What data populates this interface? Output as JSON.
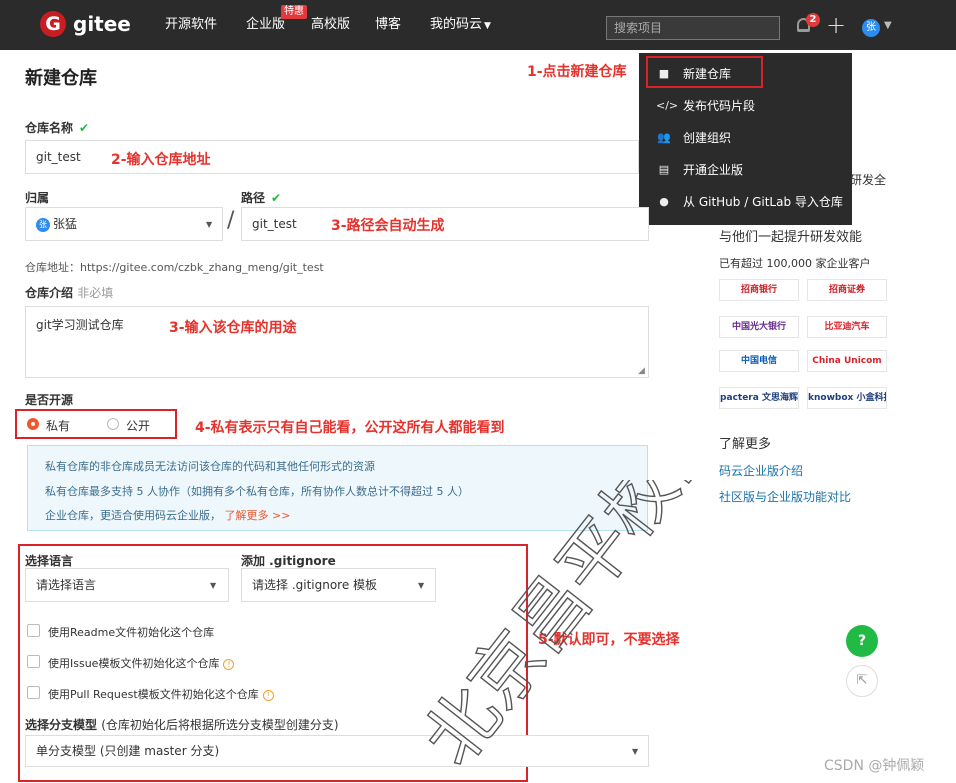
{
  "navbar": {
    "brand": "gitee",
    "items": [
      "开源软件",
      "企业版",
      "高校版",
      "博客",
      "我的码云"
    ],
    "special_badge": "特惠",
    "search_placeholder": "搜索项目",
    "notification_count": "2",
    "avatar_text": "张"
  },
  "dropdown": {
    "items": [
      "新建仓库",
      "发布代码片段",
      "创建组织",
      "开通企业版",
      "从 GitHub / GitLab 导入仓库"
    ]
  },
  "page": {
    "title": "新建仓库"
  },
  "form": {
    "repo_name_label": "仓库名称",
    "repo_name_value": "git_test",
    "owner_label": "归属",
    "owner_value": "张猛",
    "path_label": "路径",
    "path_value": "git_test",
    "repo_url": "仓库地址：https://gitee.com/czbk_zhang_meng/git_test",
    "desc_label": "仓库介绍",
    "desc_hint": "非必填",
    "desc_value": "git学习测试仓库",
    "open_label": "是否开源",
    "radio_private": "私有",
    "radio_public": "公开",
    "info_lines": [
      "私有仓库的非仓库成员无法访问该仓库的代码和其他任何形式的资源",
      "私有仓库最多支持 5 人协作（如拥有多个私有仓库，所有协作人数总计不得超过 5 人）",
      "企业仓库，更适合使用码云企业版，"
    ],
    "info_link": "了解更多 >>",
    "lang_label": "选择语言",
    "lang_placeholder": "请选择语言",
    "gitignore_label": "添加 .gitignore",
    "gitignore_placeholder": "请选择 .gitignore 模板",
    "checkboxes": [
      "使用Readme文件初始化这个仓库",
      "使用Issue模板文件初始化这个仓库",
      "使用Pull Request模板文件初始化这个仓库"
    ],
    "branch_label": "选择分支模型",
    "branch_hint": "(仓库初始化后将根据所选分支模型创建分支)",
    "branch_value": "单分支模型 (只创建 master 分支)"
  },
  "annotations": [
    "1-点击新建仓库",
    "2-输入仓库地址",
    "3-路径会自动生成",
    "3-输入该仓库的用途",
    "4-私有表示只有自己能看，公开这所有人都能看到",
    "5-默认即可，不要选择"
  ],
  "sidebar": {
    "partial_text": "研发全",
    "tagline": "与他们一起提升研发效能",
    "customers": "已有超过 100,000 家企业客户",
    "logos": [
      "招商银行",
      "招商证券",
      "中国光大银行",
      "比亚迪汽车",
      "中国电信",
      "China Unicom",
      "pactera 文思海辉",
      "knowbox 小盒科技"
    ],
    "learn_more": "了解更多",
    "link1": "码云企业版介绍",
    "link2": "社区版与企业版功能对比"
  },
  "watermark": "CSDN @钟佩颖",
  "overlay_watermark": "北京昌平校区",
  "colors": {
    "annotation": "#e5322d",
    "navbar": "#2b2b2b",
    "accent": "#f1572f",
    "check": "#21ba45"
  }
}
